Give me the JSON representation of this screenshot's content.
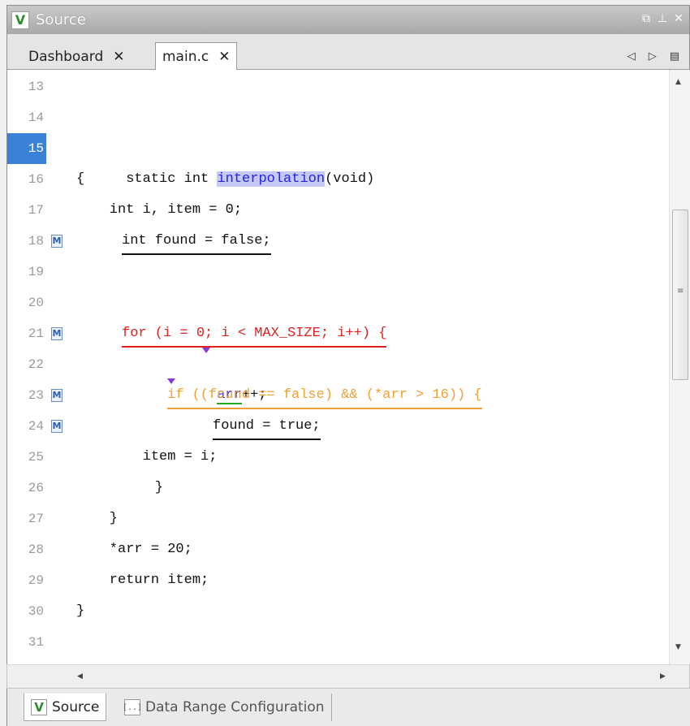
{
  "window": {
    "title": "Source",
    "logo": "V",
    "controls": [
      "restore-icon",
      "pin-icon",
      "close-icon"
    ],
    "control_glyphs": [
      "⧉",
      "⊥",
      "✕"
    ]
  },
  "tabs": [
    {
      "label": "Dashboard",
      "close": "✕"
    },
    {
      "label": "main.c",
      "close": "✕"
    }
  ],
  "tab_nav": {
    "prev": "◁",
    "next": "▷",
    "menu": "▤"
  },
  "editor": {
    "lines": [
      {
        "num": "13",
        "text": ""
      },
      {
        "num": "14",
        "text": ""
      },
      {
        "num": "15",
        "pre": "static int ",
        "highlight": "interpolation",
        "post": "(void)",
        "active": true
      },
      {
        "num": "16",
        "text": "{"
      },
      {
        "num": "17",
        "text": "    int i, item = 0;"
      },
      {
        "num": "18",
        "text": "int found = false;",
        "badge": "M"
      },
      {
        "num": "19",
        "text": ""
      },
      {
        "num": "20",
        "text": ""
      },
      {
        "num": "21",
        "text": "for (i = 0; i < MAX_SIZE; i++) {",
        "badge": "M"
      },
      {
        "num": "22",
        "highlight": "arr",
        "post": "++;"
      },
      {
        "num": "23",
        "text": "if ((found == false) && (*arr > 16)) {",
        "badge": "M"
      },
      {
        "num": "24",
        "text": "found = true;",
        "badge": "M"
      },
      {
        "num": "25",
        "text": "        item = i;"
      },
      {
        "num": "26",
        "text": "    }"
      },
      {
        "num": "27",
        "text": "    }"
      },
      {
        "num": "28",
        "text": "    *arr = 20;"
      },
      {
        "num": "29",
        "text": "    return item;"
      },
      {
        "num": "30",
        "text": "}"
      },
      {
        "num": "31",
        "text": ""
      }
    ]
  },
  "scrollbars": {
    "up": "▲",
    "down": "▼",
    "left": "◀",
    "right": "▶",
    "grip": "≡"
  },
  "bottom_tabs": [
    {
      "label": "Source",
      "icon": "V"
    },
    {
      "label": "Data Range Configuration",
      "icon": "[..]"
    }
  ],
  "colors": {
    "active_line": "#3a82d8",
    "red_defect": "#e12020",
    "orange_defect": "#f0a030",
    "highlight": "#c6c8f5",
    "marker": "#8a3adb"
  }
}
